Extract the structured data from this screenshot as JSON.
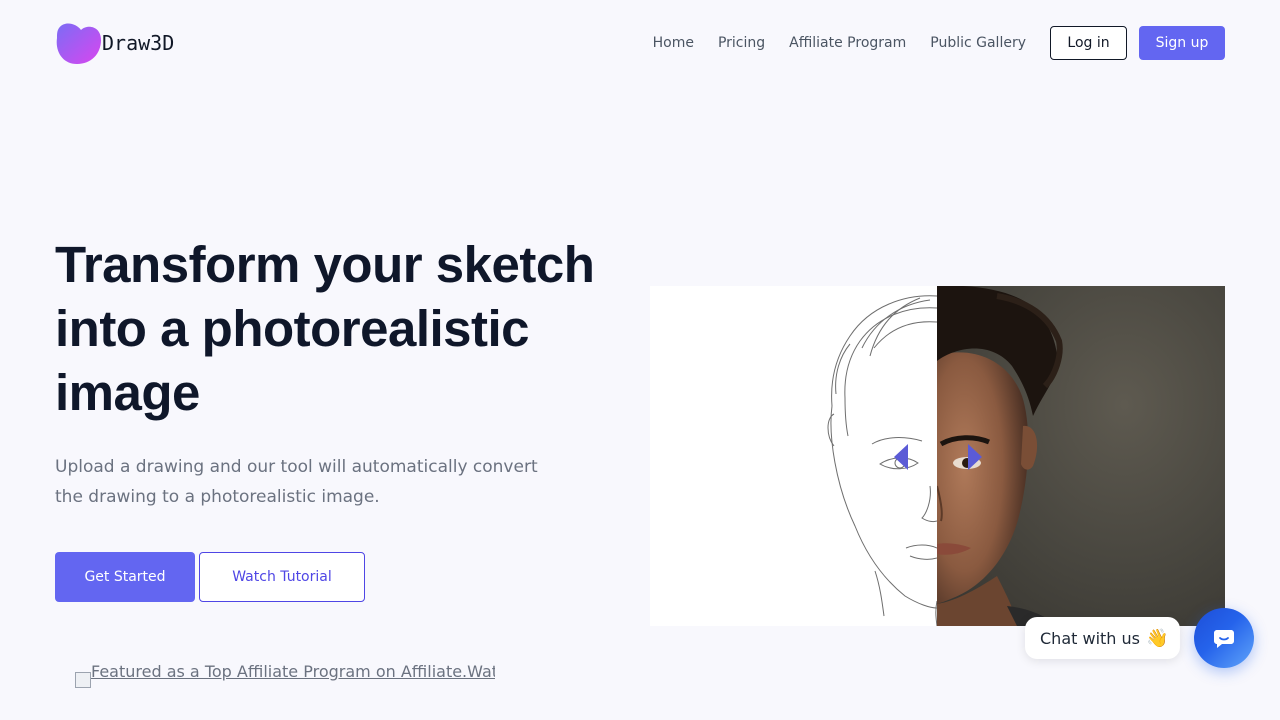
{
  "brand": {
    "name": "Draw3D",
    "accent": "#6366f1"
  },
  "nav": {
    "links": [
      "Home",
      "Pricing",
      "Affiliate Program",
      "Public Gallery"
    ],
    "login_label": "Log in",
    "signup_label": "Sign up"
  },
  "hero": {
    "title": "Transform your sketch into a photorealistic image",
    "subtitle": "Upload a drawing and our tool will automatically convert the drawing to a photorealistic image.",
    "primary_cta": "Get Started",
    "secondary_cta": "Watch Tutorial",
    "featured_alt": "Featured as a Top Affiliate Program on Affiliate.Watch"
  },
  "compare": {
    "left_image": "sketch drawing of a face",
    "right_image": "photorealistic face",
    "icons": [
      "chevron-left-icon",
      "chevron-right-icon"
    ]
  },
  "chat": {
    "bubble_text": "Chat with us",
    "bubble_emoji": "👋",
    "button_icon": "chat-icon"
  }
}
